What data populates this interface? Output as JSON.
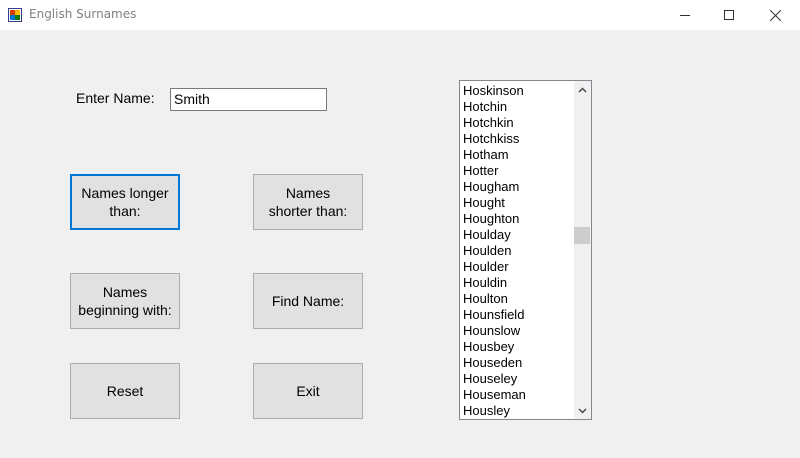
{
  "window": {
    "title": "English Surnames",
    "icon": "app-icon",
    "controls": [
      "minimize-icon",
      "maximize-icon",
      "close-icon"
    ]
  },
  "form": {
    "enter_name_label": "Enter Name:",
    "name_input_value": "Smith"
  },
  "buttons": {
    "longer_than": "Names longer\nthan:",
    "shorter_than": "Names\nshorter than:",
    "beginning_with": "Names\nbeginning with:",
    "find_name": "Find Name:",
    "reset": "Reset",
    "exit": "Exit"
  },
  "list": {
    "items": [
      "Hoskinson",
      "Hotchin",
      "Hotchkin",
      "Hotchkiss",
      "Hotham",
      "Hotter",
      "Hougham",
      "Hought",
      "Houghton",
      "Houlday",
      "Houlden",
      "Houlder",
      "Houldin",
      "Houlton",
      "Hounsfield",
      "Hounslow",
      "Housbey",
      "Houseden",
      "Houseley",
      "Houseman",
      "Housley"
    ],
    "scroll_position": 0.45
  },
  "colors": {
    "window_bg": "#f0f0f0",
    "focus_border": "#0078d7",
    "button_bg": "#e1e1e1"
  }
}
